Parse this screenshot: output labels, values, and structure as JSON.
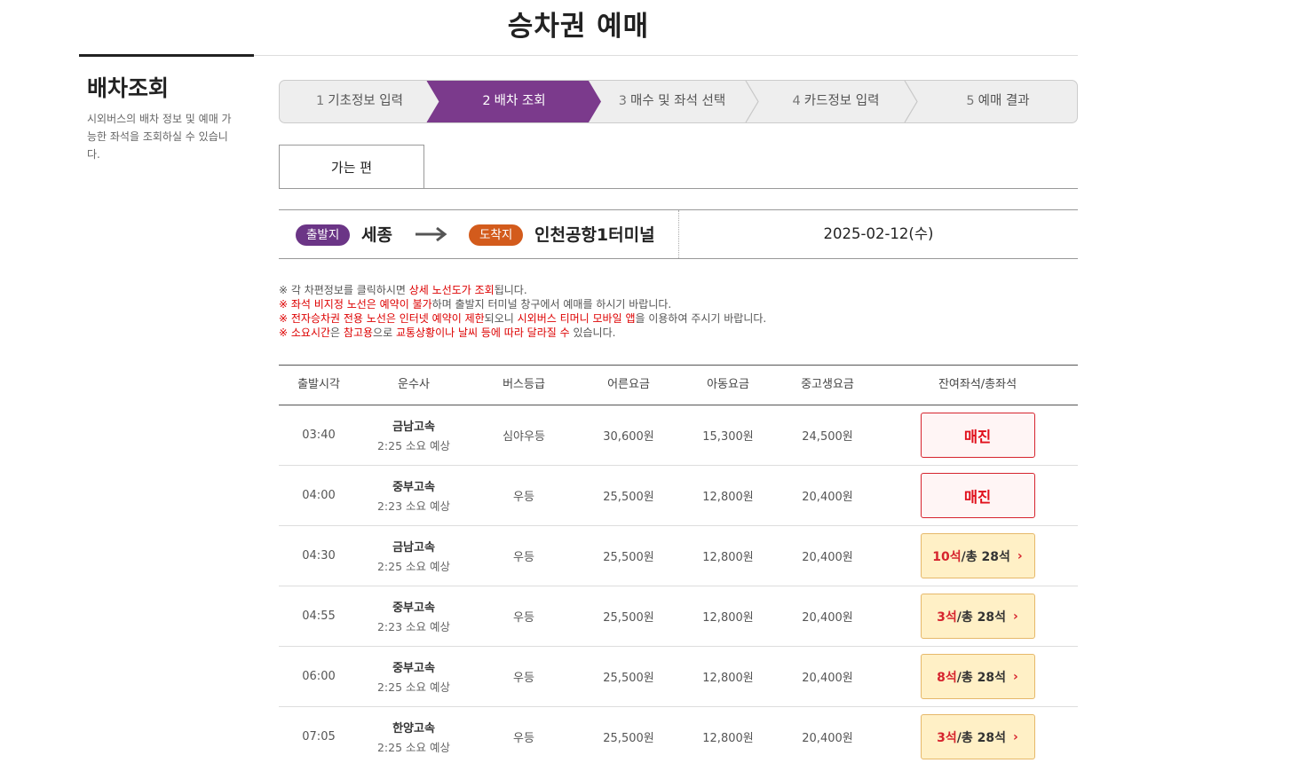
{
  "page_title": "승차권 예매",
  "sidebar": {
    "title": "배차조회",
    "description": "시외버스의 배차 정보 및 예매 가능한 좌석을 조회하실 수 있습니다."
  },
  "steps": [
    {
      "num": "1",
      "label": "기초정보 입력"
    },
    {
      "num": "2",
      "label": "배차 조회",
      "active": true
    },
    {
      "num": "3",
      "label": "매수 및 좌석 선택"
    },
    {
      "num": "4",
      "label": "카드정보 입력"
    },
    {
      "num": "5",
      "label": "예매 결과"
    }
  ],
  "tab": {
    "label": "가는 편"
  },
  "route": {
    "dep_label": "출발지",
    "dep_city": "세종",
    "arr_label": "도착지",
    "arr_city": "인천공항1터미널",
    "date": "2025-02-12(수)"
  },
  "notices": {
    "n1_a": "※ 각 차편정보를 클릭하시면 ",
    "n1_b": "상세 노선도가 조회",
    "n1_c": "됩니다.",
    "n2_a": "※ ",
    "n2_b": "좌석 비지정 노선은 예약이 불가",
    "n2_c": "하며 출발지 터미널 창구에서 예매를 하시기 바랍니다.",
    "n3_a": "※ ",
    "n3_b": "전자승차권 전용 노선은 인터넷 예약이 제한",
    "n3_c": "되오니 ",
    "n3_d": "시외버스 티머니 모바일 앱",
    "n3_e": "을 이용하여 주시기 바랍니다.",
    "n4_a": "※ ",
    "n4_b": "소요시간",
    "n4_c": "은 ",
    "n4_d": "참고용",
    "n4_e": "으로 ",
    "n4_f": "교통상황이나 날씨 등에 따라 달라질 수",
    "n4_g": " 있습니다."
  },
  "table": {
    "headers": {
      "time": "출발시각",
      "company": "운수사",
      "grade": "버스등급",
      "adult": "어른요금",
      "child": "아동요금",
      "student": "중고생요금",
      "seats": "잔여좌석/총좌석"
    },
    "rows": [
      {
        "time": "03:40",
        "company": "금남고속",
        "duration": "2:25 소요 예상",
        "grade": "심야우등",
        "adult": "30,600원",
        "child": "15,300원",
        "student": "24,500원",
        "status": "매진"
      },
      {
        "time": "04:00",
        "company": "중부고속",
        "duration": "2:23 소요 예상",
        "grade": "우등",
        "adult": "25,500원",
        "child": "12,800원",
        "student": "20,400원",
        "status": "매진"
      },
      {
        "time": "04:30",
        "company": "금남고속",
        "duration": "2:25 소요 예상",
        "grade": "우등",
        "adult": "25,500원",
        "child": "12,800원",
        "student": "20,400원",
        "left": "10석",
        "total": " /총 28석"
      },
      {
        "time": "04:55",
        "company": "중부고속",
        "duration": "2:23 소요 예상",
        "grade": "우등",
        "adult": "25,500원",
        "child": "12,800원",
        "student": "20,400원",
        "left": "3석",
        "total": " /총 28석"
      },
      {
        "time": "06:00",
        "company": "중부고속",
        "duration": "2:25 소요 예상",
        "grade": "우등",
        "adult": "25,500원",
        "child": "12,800원",
        "student": "20,400원",
        "left": "8석",
        "total": " /총 28석"
      },
      {
        "time": "07:05",
        "company": "한양고속",
        "duration": "2:25 소요 예상",
        "grade": "우등",
        "adult": "25,500원",
        "child": "12,800원",
        "student": "20,400원",
        "left": "3석",
        "total": " /총 28석"
      }
    ]
  },
  "colors": {
    "accent": "#7b3a8c",
    "departure": "#6b3586",
    "arrival": "#d35b1c",
    "soldout": "#e0101c",
    "available_bg": "#fff0c6"
  }
}
